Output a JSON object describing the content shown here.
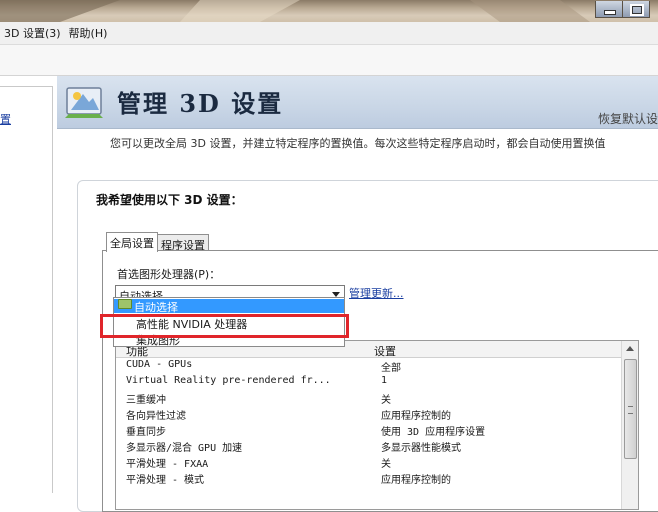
{
  "window": {
    "menu": [
      "3D 设置(3)",
      "帮助(H)"
    ]
  },
  "sidebar": {
    "link_fragment": "置"
  },
  "header": {
    "title": "管理 3D 设置",
    "restore": "恢复默认设",
    "description": "您可以更改全局 3D 设置，并建立特定程序的置换值。每次这些特定程序启动时，都会自动使用置换值"
  },
  "panel": {
    "heading": "我希望使用以下 3D 设置：",
    "tabs": [
      "全局设置",
      "程序设置"
    ],
    "preferred_label": "首选图形处理器(P)：",
    "preferred_value": "自动选择",
    "manage_link": "管理更新..."
  },
  "dropdown_options": [
    "自动选择",
    "高性能 NVIDIA 处理器",
    "集成图形"
  ],
  "list": {
    "col_feature": "功能",
    "col_setting": "设置",
    "rows": [
      {
        "feature": "CUDA - GPUs",
        "setting": "全部"
      },
      {
        "feature": "Virtual Reality pre-rendered fr...",
        "setting": "1"
      },
      {
        "feature": "三重缓冲",
        "setting": "关"
      },
      {
        "feature": "各向异性过滤",
        "setting": "应用程序控制的"
      },
      {
        "feature": "垂直同步",
        "setting": "使用 3D 应用程序设置"
      },
      {
        "feature": "多显示器/混合 GPU 加速",
        "setting": "多显示器性能模式"
      },
      {
        "feature": "平滑处理 - FXAA",
        "setting": "关"
      },
      {
        "feature": "平滑处理 - 模式",
        "setting": "应用程序控制的"
      }
    ]
  },
  "colors": {
    "highlight": "#e0252a",
    "link": "#1a3ea0",
    "selection": "#3399ff"
  }
}
